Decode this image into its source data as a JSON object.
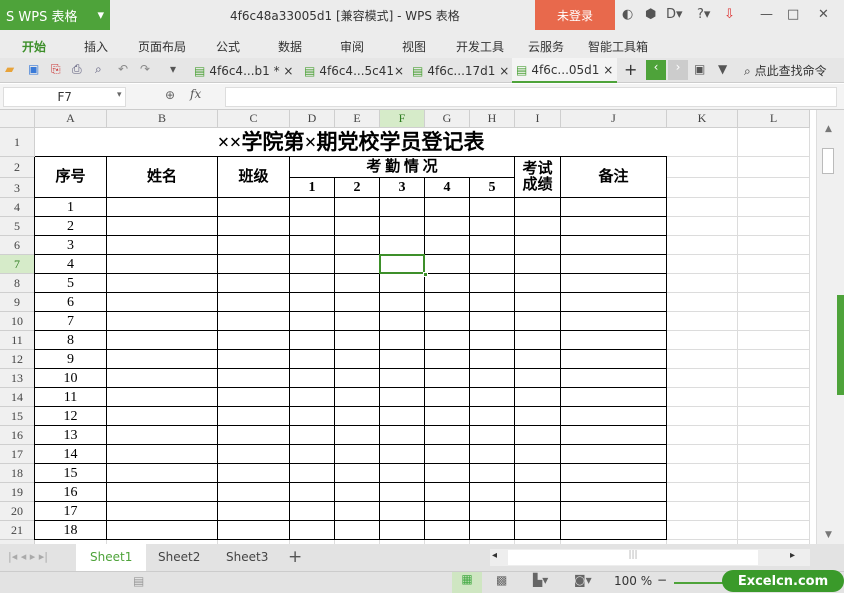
{
  "app": {
    "logo": "S WPS 表格",
    "title": "4f6c48a33005d1 [兼容模式] - WPS 表格",
    "login": "未登录"
  },
  "menu": [
    "开始",
    "插入",
    "页面布局",
    "公式",
    "数据",
    "审阅",
    "视图",
    "开发工具",
    "云服务",
    "智能工具箱"
  ],
  "doc_tabs": [
    {
      "label": "4f6c4...b1 * ×"
    },
    {
      "label": "4f6c4...5c41×"
    },
    {
      "label": "4f6c...17d1 ×"
    },
    {
      "label": "4f6c...05d1 ×",
      "active": true
    }
  ],
  "search_cmd": "点此查找命令",
  "formula_bar": {
    "cell_ref": "F7",
    "fx": "fx",
    "value": ""
  },
  "columns": [
    "A",
    "B",
    "C",
    "D",
    "E",
    "F",
    "G",
    "H",
    "I",
    "J",
    "K",
    "L"
  ],
  "selected": {
    "col": "F",
    "row": 7
  },
  "sheet": {
    "title": "××学院第×期党校学员登记表",
    "headers": {
      "seq": "序号",
      "name": "姓名",
      "class": "班级",
      "attendance": "考 勤 情 况",
      "att_cols": [
        "1",
        "2",
        "3",
        "4",
        "5"
      ],
      "exam": "考试成绩",
      "remark": "备注"
    },
    "seq_numbers": [
      "1",
      "2",
      "3",
      "4",
      "5",
      "6",
      "7",
      "8",
      "9",
      "10",
      "11",
      "12",
      "13",
      "14",
      "15",
      "16",
      "17",
      "18"
    ]
  },
  "sheet_tabs": [
    "Sheet1",
    "Sheet2",
    "Sheet3"
  ],
  "active_sheet": "Sheet1",
  "zoom": "100 %",
  "watermark": "Excelcn.com"
}
